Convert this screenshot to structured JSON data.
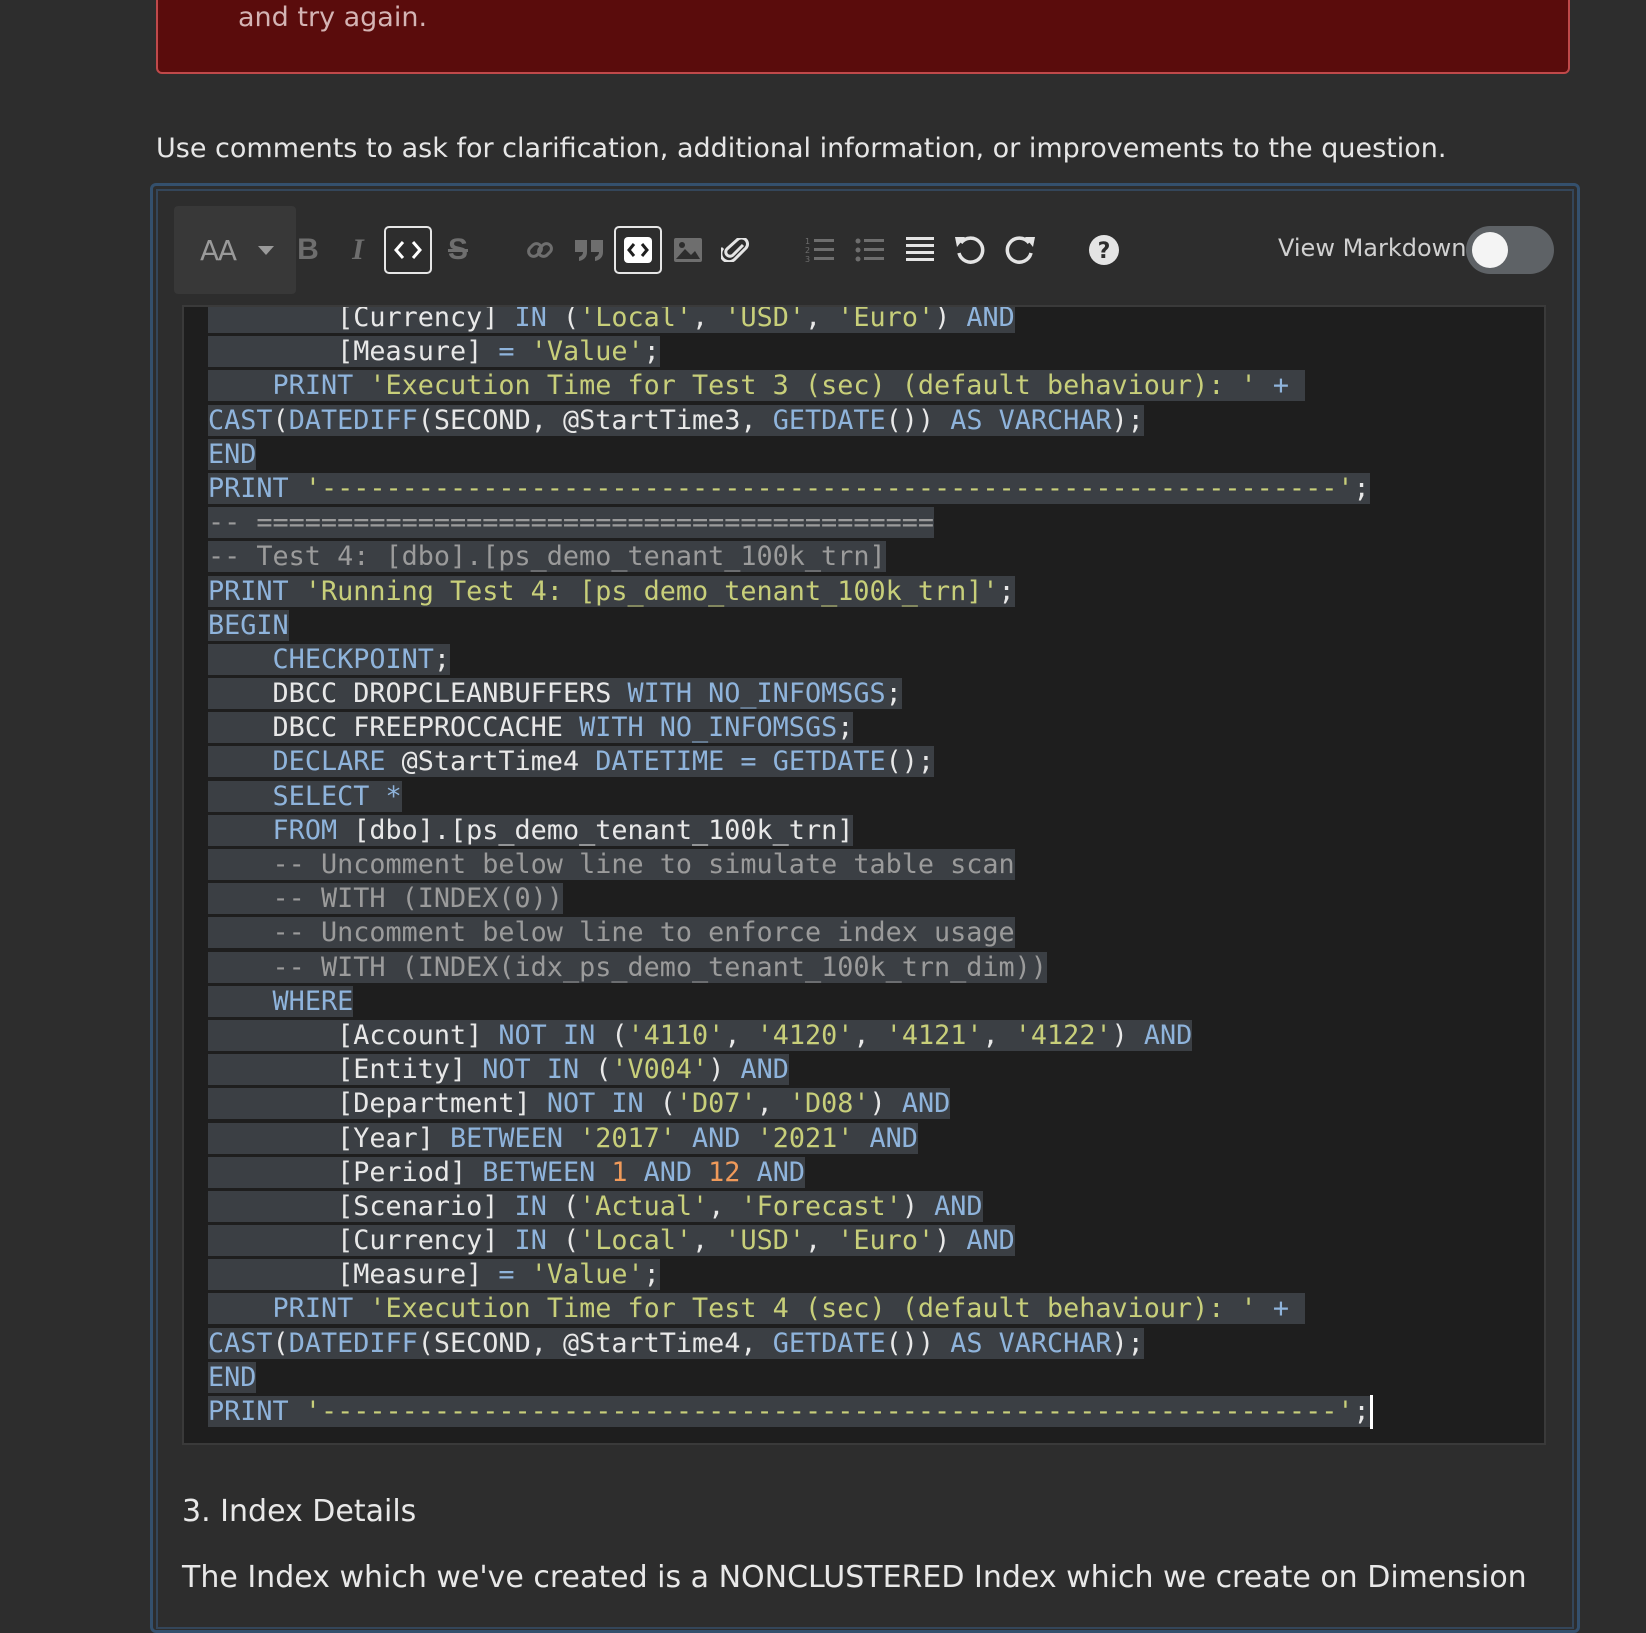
{
  "notice": {
    "text": "and try again."
  },
  "comment_hint": "Use comments to ask for clarification, additional information, or improvements to the question.",
  "toolbar": {
    "heading_label": "AA",
    "buttons": [
      {
        "name": "bold-button",
        "icon": "bold-icon",
        "glyph": "B"
      },
      {
        "name": "italic-button",
        "icon": "italic-icon",
        "glyph": "I"
      },
      {
        "name": "inline-code-button",
        "icon": "inline-code-icon",
        "glyph": "<>"
      },
      {
        "name": "strikethrough-button",
        "icon": "strikethrough-icon",
        "glyph": "S"
      },
      {
        "name": "link-button",
        "icon": "link-icon"
      },
      {
        "name": "blockquote-button",
        "icon": "quote-icon"
      },
      {
        "name": "code-block-button",
        "icon": "code-block-icon"
      },
      {
        "name": "image-button",
        "icon": "image-icon"
      },
      {
        "name": "snippet-button",
        "icon": "snippet-icon"
      },
      {
        "name": "ordered-list-button",
        "icon": "ordered-list-icon"
      },
      {
        "name": "unordered-list-button",
        "icon": "unordered-list-icon"
      },
      {
        "name": "horizontal-rule-button",
        "icon": "horizontal-rule-icon"
      },
      {
        "name": "undo-button",
        "icon": "undo-icon"
      },
      {
        "name": "redo-button",
        "icon": "redo-icon"
      },
      {
        "name": "help-button",
        "icon": "help-icon"
      }
    ],
    "view_markdown_label": "View Markdown",
    "view_markdown_on": false
  },
  "code_lines": [
    [
      [
        "        ",
        "id"
      ],
      [
        "[Currency]",
        "id"
      ],
      [
        " IN ",
        "kw"
      ],
      [
        "(",
        "id"
      ],
      [
        "'Local'",
        "str"
      ],
      [
        ", ",
        "id"
      ],
      [
        "'USD'",
        "str"
      ],
      [
        ", ",
        "id"
      ],
      [
        "'Euro'",
        "str"
      ],
      [
        ") ",
        "id"
      ],
      [
        "AND",
        "kw"
      ]
    ],
    [
      [
        "        ",
        "id"
      ],
      [
        "[Measure]",
        "id"
      ],
      [
        " = ",
        "kw"
      ],
      [
        "'Value'",
        "str"
      ],
      [
        ";",
        "id"
      ]
    ],
    [
      [
        "    ",
        "id"
      ],
      [
        "PRINT ",
        "kw"
      ],
      [
        "'Execution Time for Test 3 (sec) (default behaviour): '",
        "str"
      ],
      [
        " + ",
        "kw"
      ]
    ],
    [
      [
        "CAST",
        "kw"
      ],
      [
        "(",
        "id"
      ],
      [
        "DATEDIFF",
        "kw"
      ],
      [
        "(SECOND, @StartTime3, ",
        "id"
      ],
      [
        "GETDATE",
        "kw"
      ],
      [
        "()) ",
        "id"
      ],
      [
        "AS VARCHAR",
        "kw"
      ],
      [
        ");",
        "id"
      ]
    ],
    [
      [
        "END",
        "kw"
      ]
    ],
    [
      [
        "PRINT ",
        "kw"
      ],
      [
        "'---------------------------------------------------------------'",
        "str"
      ],
      [
        ";",
        "id"
      ]
    ],
    [
      [
        "-- ==========================================",
        "cm"
      ]
    ],
    [
      [
        "-- Test 4: [dbo].[ps_demo_tenant_100k_trn]",
        "cm"
      ]
    ],
    [
      [
        "PRINT ",
        "kw"
      ],
      [
        "'Running Test 4: [ps_demo_tenant_100k_trn]'",
        "str"
      ],
      [
        ";",
        "id"
      ]
    ],
    [
      [
        "BEGIN",
        "kw"
      ]
    ],
    [
      [
        "    ",
        "id"
      ],
      [
        "CHECKPOINT",
        "kw"
      ],
      [
        ";",
        "id"
      ]
    ],
    [
      [
        "    ",
        "id"
      ],
      [
        "DBCC DROPCLEANBUFFERS ",
        "id"
      ],
      [
        "WITH NO_INFOMSGS",
        "kw"
      ],
      [
        ";",
        "id"
      ]
    ],
    [
      [
        "    ",
        "id"
      ],
      [
        "DBCC FREEPROCCACHE ",
        "id"
      ],
      [
        "WITH NO_INFOMSGS",
        "kw"
      ],
      [
        ";",
        "id"
      ]
    ],
    [
      [
        "    ",
        "id"
      ],
      [
        "DECLARE ",
        "kw"
      ],
      [
        "@StartTime4 ",
        "id"
      ],
      [
        "DATETIME = GETDATE",
        "kw"
      ],
      [
        "();",
        "id"
      ]
    ],
    [
      [
        "    ",
        "id"
      ],
      [
        "SELECT *",
        "kw"
      ]
    ],
    [
      [
        "    ",
        "id"
      ],
      [
        "FROM ",
        "kw"
      ],
      [
        "[dbo].[ps_demo_tenant_100k_trn]",
        "id"
      ]
    ],
    [
      [
        "    ",
        "id"
      ],
      [
        "-- Uncomment below line to simulate table scan",
        "cm"
      ]
    ],
    [
      [
        "    ",
        "id"
      ],
      [
        "-- WITH (INDEX(0))",
        "cm"
      ]
    ],
    [
      [
        "    ",
        "id"
      ],
      [
        "-- Uncomment below line to enforce index usage",
        "cm"
      ]
    ],
    [
      [
        "    ",
        "id"
      ],
      [
        "-- WITH (INDEX(idx_ps_demo_tenant_100k_trn_dim))",
        "cm"
      ]
    ],
    [
      [
        "    ",
        "id"
      ],
      [
        "WHERE",
        "kw"
      ]
    ],
    [
      [
        "        ",
        "id"
      ],
      [
        "[Account]",
        "id"
      ],
      [
        " NOT IN ",
        "kw"
      ],
      [
        "(",
        "id"
      ],
      [
        "'4110'",
        "str"
      ],
      [
        ", ",
        "id"
      ],
      [
        "'4120'",
        "str"
      ],
      [
        ", ",
        "id"
      ],
      [
        "'4121'",
        "str"
      ],
      [
        ", ",
        "id"
      ],
      [
        "'4122'",
        "str"
      ],
      [
        ") ",
        "id"
      ],
      [
        "AND",
        "kw"
      ]
    ],
    [
      [
        "        ",
        "id"
      ],
      [
        "[Entity]",
        "id"
      ],
      [
        " NOT IN ",
        "kw"
      ],
      [
        "(",
        "id"
      ],
      [
        "'V004'",
        "str"
      ],
      [
        ") ",
        "id"
      ],
      [
        "AND",
        "kw"
      ]
    ],
    [
      [
        "        ",
        "id"
      ],
      [
        "[Department]",
        "id"
      ],
      [
        " NOT IN ",
        "kw"
      ],
      [
        "(",
        "id"
      ],
      [
        "'D07'",
        "str"
      ],
      [
        ", ",
        "id"
      ],
      [
        "'D08'",
        "str"
      ],
      [
        ") ",
        "id"
      ],
      [
        "AND",
        "kw"
      ]
    ],
    [
      [
        "        ",
        "id"
      ],
      [
        "[Year]",
        "id"
      ],
      [
        " BETWEEN ",
        "kw"
      ],
      [
        "'2017'",
        "str"
      ],
      [
        " AND ",
        "kw"
      ],
      [
        "'2021'",
        "str"
      ],
      [
        " AND",
        "kw"
      ]
    ],
    [
      [
        "        ",
        "id"
      ],
      [
        "[Period]",
        "id"
      ],
      [
        " BETWEEN ",
        "kw"
      ],
      [
        "1",
        "num"
      ],
      [
        " AND ",
        "kw"
      ],
      [
        "12",
        "num"
      ],
      [
        " AND",
        "kw"
      ]
    ],
    [
      [
        "        ",
        "id"
      ],
      [
        "[Scenario]",
        "id"
      ],
      [
        " IN ",
        "kw"
      ],
      [
        "(",
        "id"
      ],
      [
        "'Actual'",
        "str"
      ],
      [
        ", ",
        "id"
      ],
      [
        "'Forecast'",
        "str"
      ],
      [
        ") ",
        "id"
      ],
      [
        "AND",
        "kw"
      ]
    ],
    [
      [
        "        ",
        "id"
      ],
      [
        "[Currency]",
        "id"
      ],
      [
        " IN ",
        "kw"
      ],
      [
        "(",
        "id"
      ],
      [
        "'Local'",
        "str"
      ],
      [
        ", ",
        "id"
      ],
      [
        "'USD'",
        "str"
      ],
      [
        ", ",
        "id"
      ],
      [
        "'Euro'",
        "str"
      ],
      [
        ") ",
        "id"
      ],
      [
        "AND",
        "kw"
      ]
    ],
    [
      [
        "        ",
        "id"
      ],
      [
        "[Measure]",
        "id"
      ],
      [
        " = ",
        "kw"
      ],
      [
        "'Value'",
        "str"
      ],
      [
        ";",
        "id"
      ]
    ],
    [
      [
        "    ",
        "id"
      ],
      [
        "PRINT ",
        "kw"
      ],
      [
        "'Execution Time for Test 4 (sec) (default behaviour): '",
        "str"
      ],
      [
        " + ",
        "kw"
      ]
    ],
    [
      [
        "CAST",
        "kw"
      ],
      [
        "(",
        "id"
      ],
      [
        "DATEDIFF",
        "kw"
      ],
      [
        "(SECOND, @StartTime4, ",
        "id"
      ],
      [
        "GETDATE",
        "kw"
      ],
      [
        "()) ",
        "id"
      ],
      [
        "AS VARCHAR",
        "kw"
      ],
      [
        ");",
        "id"
      ]
    ],
    [
      [
        "END",
        "kw"
      ]
    ],
    [
      [
        "PRINT ",
        "kw"
      ],
      [
        "'---------------------------------------------------------------'",
        "str"
      ],
      [
        ";",
        "id"
      ]
    ]
  ],
  "section_heading": "3. Index Details",
  "body_text": "The Index which we've created is a NONCLUSTERED Index which we create on Dimension",
  "colors": {
    "background": "#2d2d2d",
    "notice_bg": "#5a0c0c",
    "notice_border": "#c0494a",
    "editor_border": "#34506d",
    "code_bg": "#1e1e1e",
    "selection": "#3b3f44",
    "keyword": "#8fb4dc",
    "string": "#c8cf7a",
    "number": "#f09a5a",
    "comment": "#9b9b9b"
  }
}
